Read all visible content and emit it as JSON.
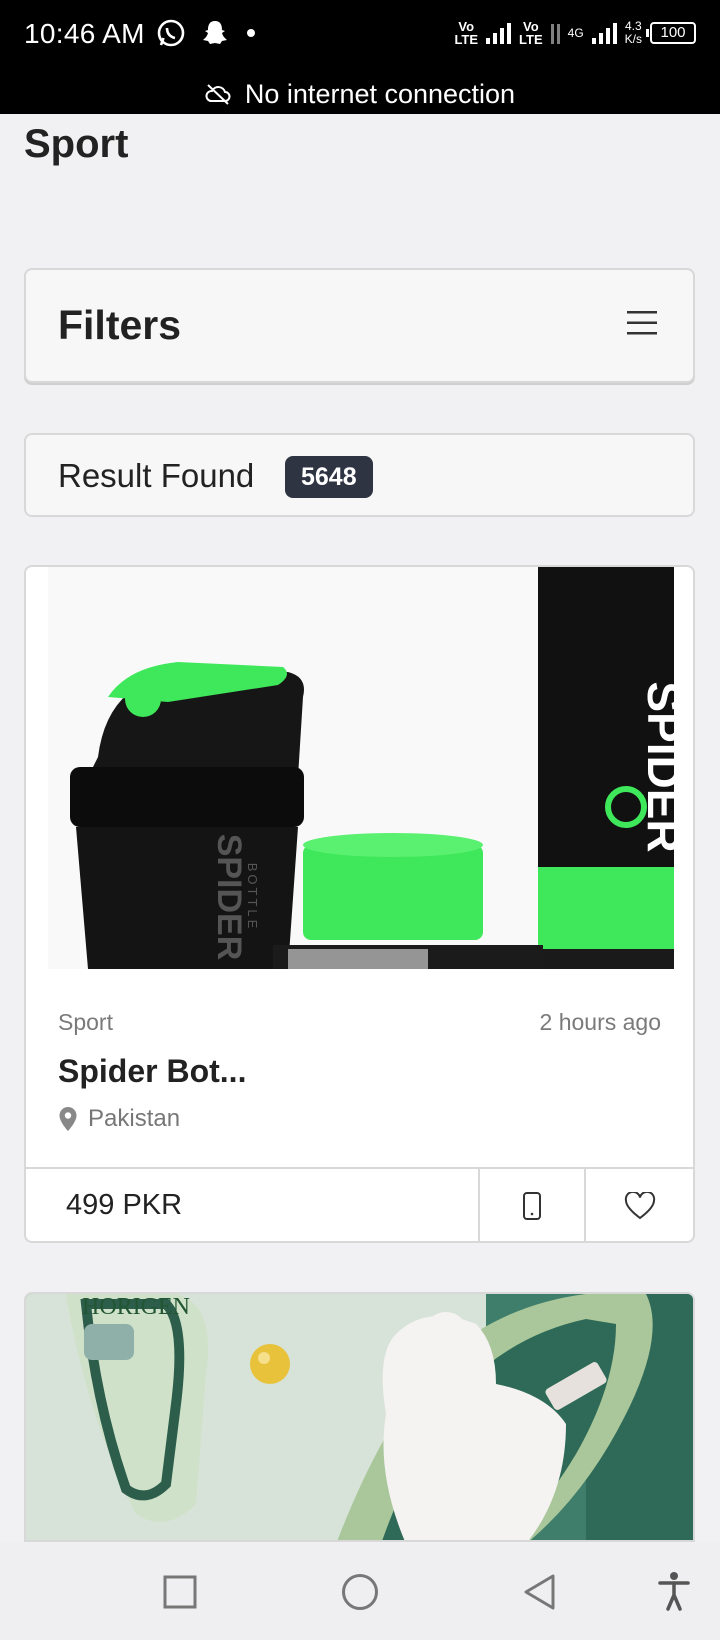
{
  "status_bar": {
    "time": "10:46 AM",
    "volte1": "Vo\nLTE",
    "volte2": "Vo\nLTE",
    "network": "4G",
    "speed_value": "4.3",
    "speed_unit": "K/s",
    "battery": "100"
  },
  "offline_banner": {
    "text": "No internet connection"
  },
  "page": {
    "title": "Sport"
  },
  "filters": {
    "title": "Filters"
  },
  "results": {
    "label": "Result Found",
    "count": "5648"
  },
  "listing": {
    "image_brand_large": "SPIDER",
    "image_brand_small": "SPIDER",
    "image_brand_sub": "BOTTLE",
    "category": "Sport",
    "time": "2 hours ago",
    "title": "Spider Bot...",
    "location": "Pakistan",
    "price": "499 PKR"
  },
  "listing2": {
    "image_brand": "HORIGEN"
  },
  "colors": {
    "accent_green": "#3ee85a",
    "badge": "#2f3442"
  },
  "icons": [
    "whatsapp-icon",
    "snapchat-icon",
    "cloud-off-icon",
    "hamburger-menu-icon",
    "location-pin-icon",
    "phone-icon",
    "heart-icon",
    "recent-apps-icon",
    "home-icon",
    "back-icon",
    "accessibility-icon"
  ]
}
